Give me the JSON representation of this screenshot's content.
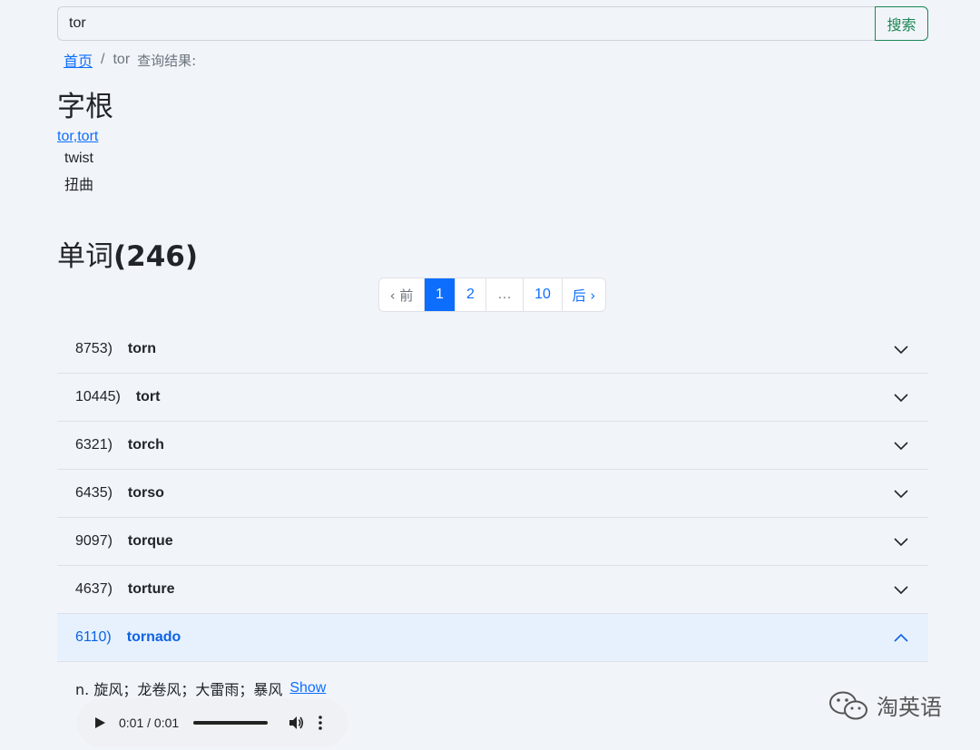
{
  "search": {
    "value": "tor",
    "button_label": "搜索"
  },
  "breadcrumb": {
    "home": "首页",
    "separator": "/",
    "query": "tor",
    "result_label": "查询结果:"
  },
  "roots": {
    "title": "字根",
    "link": "tor,tort",
    "meaning_en": "twist",
    "meaning_zh": "扭曲"
  },
  "words": {
    "title_prefix": "单词",
    "count": "(246)",
    "pagination": {
      "prev": "‹ 前",
      "pages": [
        "1",
        "2",
        "…",
        "10"
      ],
      "next": "后 ›",
      "current": "1"
    },
    "items": [
      {
        "num": "8753)",
        "word": "torn"
      },
      {
        "num": "10445)",
        "word": "tort"
      },
      {
        "num": "6321)",
        "word": "torch"
      },
      {
        "num": "6435)",
        "word": "torso"
      },
      {
        "num": "9097)",
        "word": "torque"
      },
      {
        "num": "4637)",
        "word": "torture"
      },
      {
        "num": "6110)",
        "word": "tornado"
      }
    ],
    "expanded": {
      "definition": "n. 旋风；龙卷风；大雷雨；暴风",
      "show_link": "Show",
      "audio_time": "0:01 / 0:01"
    }
  },
  "watermark": {
    "text": "淘英语",
    "icon": "wechat-icon"
  }
}
